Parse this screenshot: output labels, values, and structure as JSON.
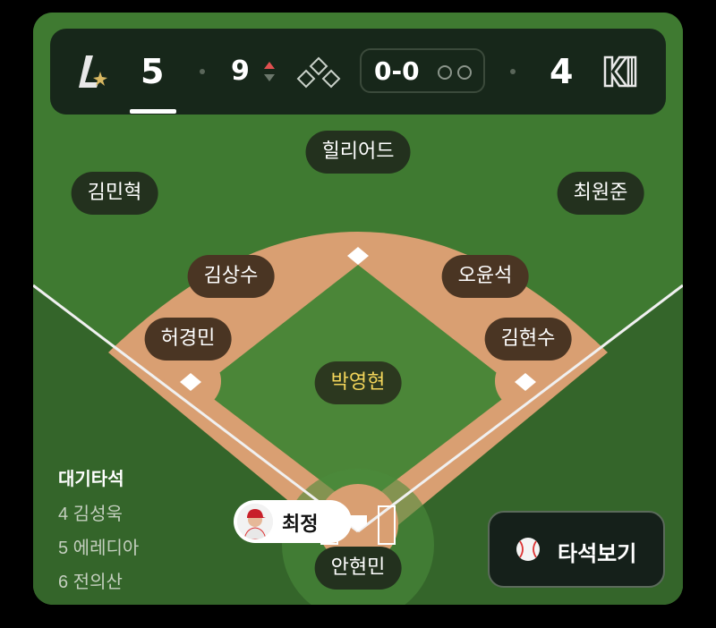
{
  "scoreboard": {
    "away_logo": "lg-twins-style-L-logo",
    "away_score": "5",
    "inning": "9",
    "inning_half": "top",
    "count": "0-0",
    "outs": 0,
    "home_score": "4",
    "home_logo": "kt-wiz-logo",
    "accent_color": "#e05050"
  },
  "fielders": {
    "center_field": "힐리어드",
    "left_field": "김민혁",
    "right_field": "최원준",
    "shortstop": "김상수",
    "second_base": "오윤석",
    "third_base": "허경민",
    "first_base": "김현수",
    "pitcher": "박영현",
    "catcher": "안현민"
  },
  "batter": {
    "name": "최정",
    "avatar_icon": "batter-avatar"
  },
  "on_deck": {
    "title": "대기타석",
    "batters": [
      "4 김성욱",
      "5 에레디아",
      "6 전의산"
    ]
  },
  "actions": {
    "view_atbat_label": "타석보기",
    "view_atbat_icon": "baseball-icon"
  }
}
